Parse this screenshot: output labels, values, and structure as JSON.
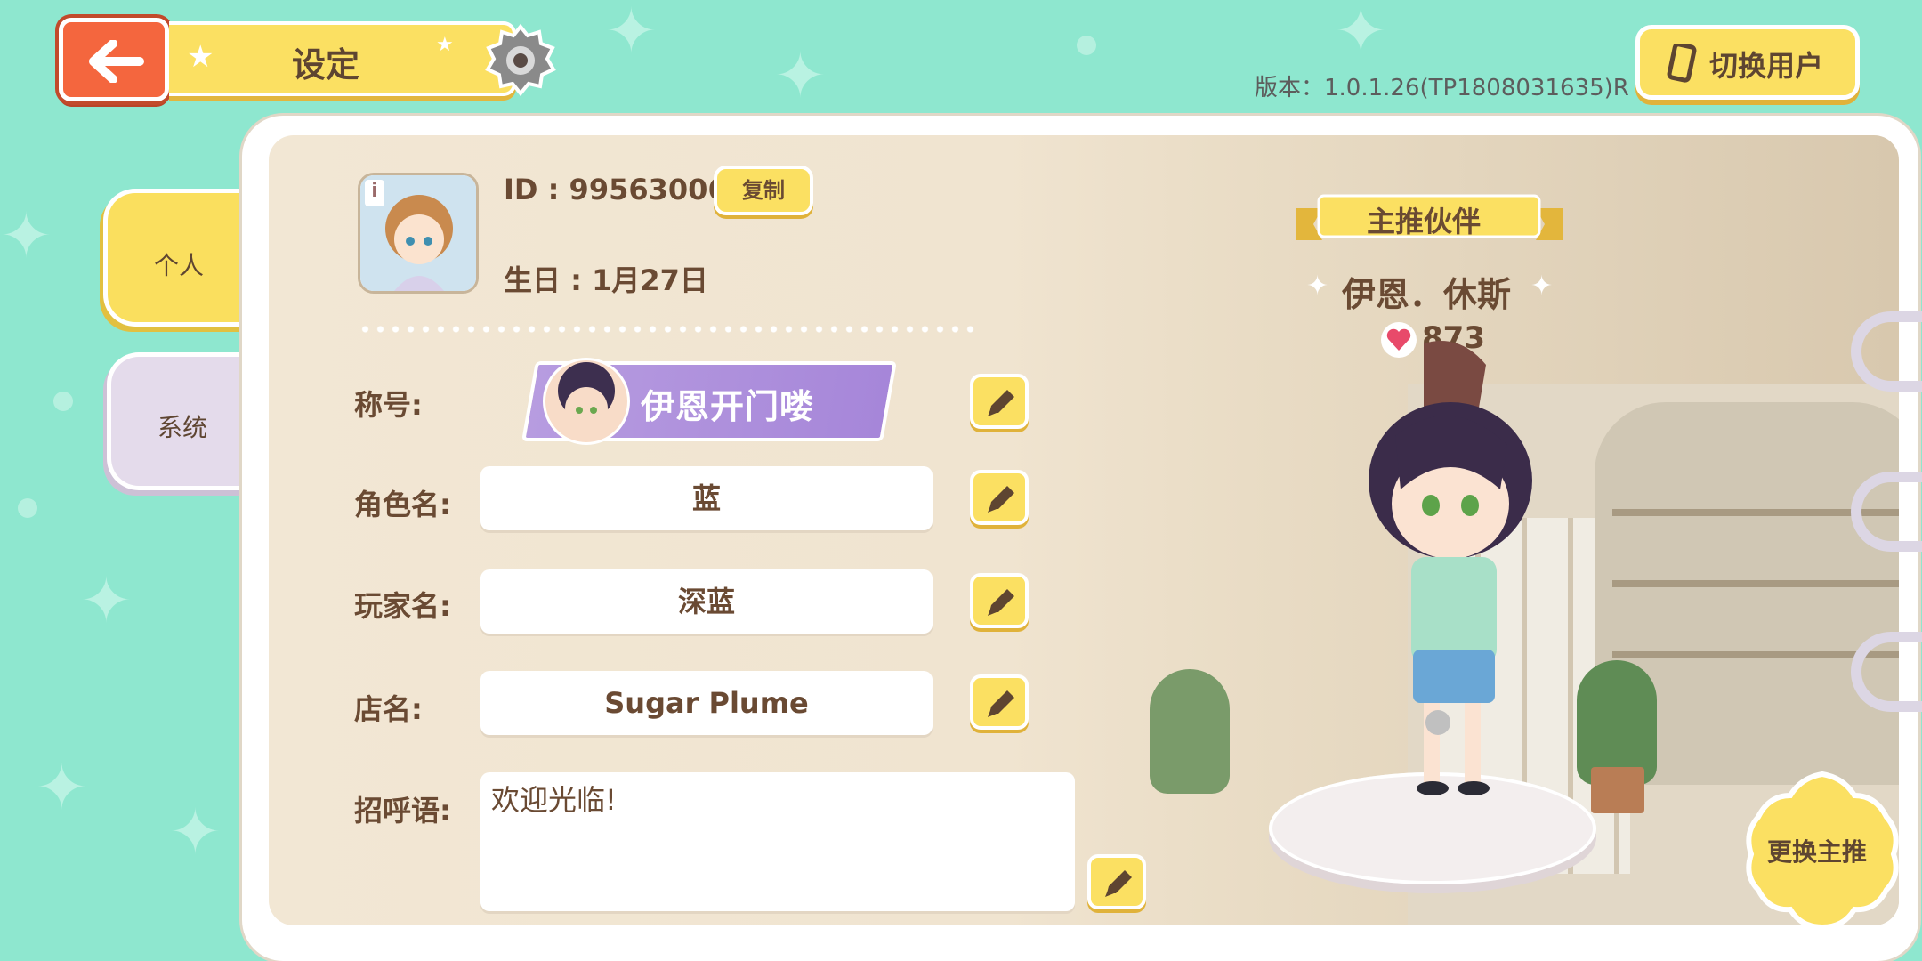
{
  "header": {
    "title": "设定",
    "version": "版本：1.0.1.26(TP1808031635)R",
    "switch_user_label": "切换用户"
  },
  "tabs": {
    "personal": "个人",
    "system": "系统"
  },
  "profile": {
    "id_text": "ID : 99563006",
    "copy_label": "复制",
    "birthday_text": "生日 : 1月27日",
    "avatar_badge": "i"
  },
  "fields": {
    "title_label": "称号:",
    "title_badge_text": "伊恩开门喽",
    "role_label": "角色名:",
    "role_value": "蓝",
    "player_label": "玩家名:",
    "player_value": "深蓝",
    "shop_label": "店名:",
    "shop_value": "Sugar Plume",
    "greeting_label": "招呼语:",
    "greeting_value": "欢迎光临!"
  },
  "partner": {
    "ribbon_label": "主推伙伴",
    "name": "伊恩．休斯",
    "affection": "873",
    "change_label": "更换主推"
  },
  "colors": {
    "background": "#8ee7cf",
    "accent_yellow": "#fbe062",
    "back_button": "#f4663e",
    "title_badge": "#a686d9",
    "text_brown": "#6a4a33"
  }
}
